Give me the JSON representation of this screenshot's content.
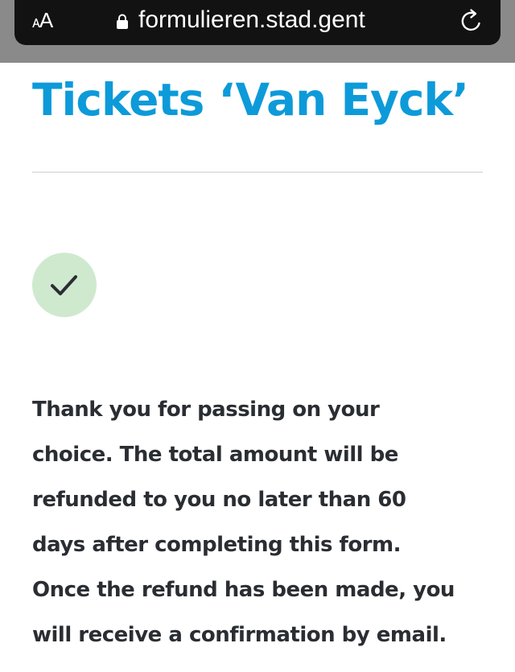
{
  "browser": {
    "text_size_label": "AA",
    "url": "formulieren.stad.gent",
    "lock_icon": "lock-icon",
    "reload_icon": "reload-icon"
  },
  "page": {
    "title": "Tickets ‘Van Eyck’",
    "status_icon": "checkmark-icon",
    "message_lines": [
      "Thank you for passing on your",
      "choice. The total amount will be",
      "refunded to you no later than 60",
      "days after completing this form.",
      "Once the refund has been made, you",
      "will receive a confirmation by email."
    ]
  },
  "colors": {
    "title": "#0d9ad9",
    "text": "#2a2e33",
    "success_bg": "#cfe9cf",
    "address_bar": "#121212"
  }
}
